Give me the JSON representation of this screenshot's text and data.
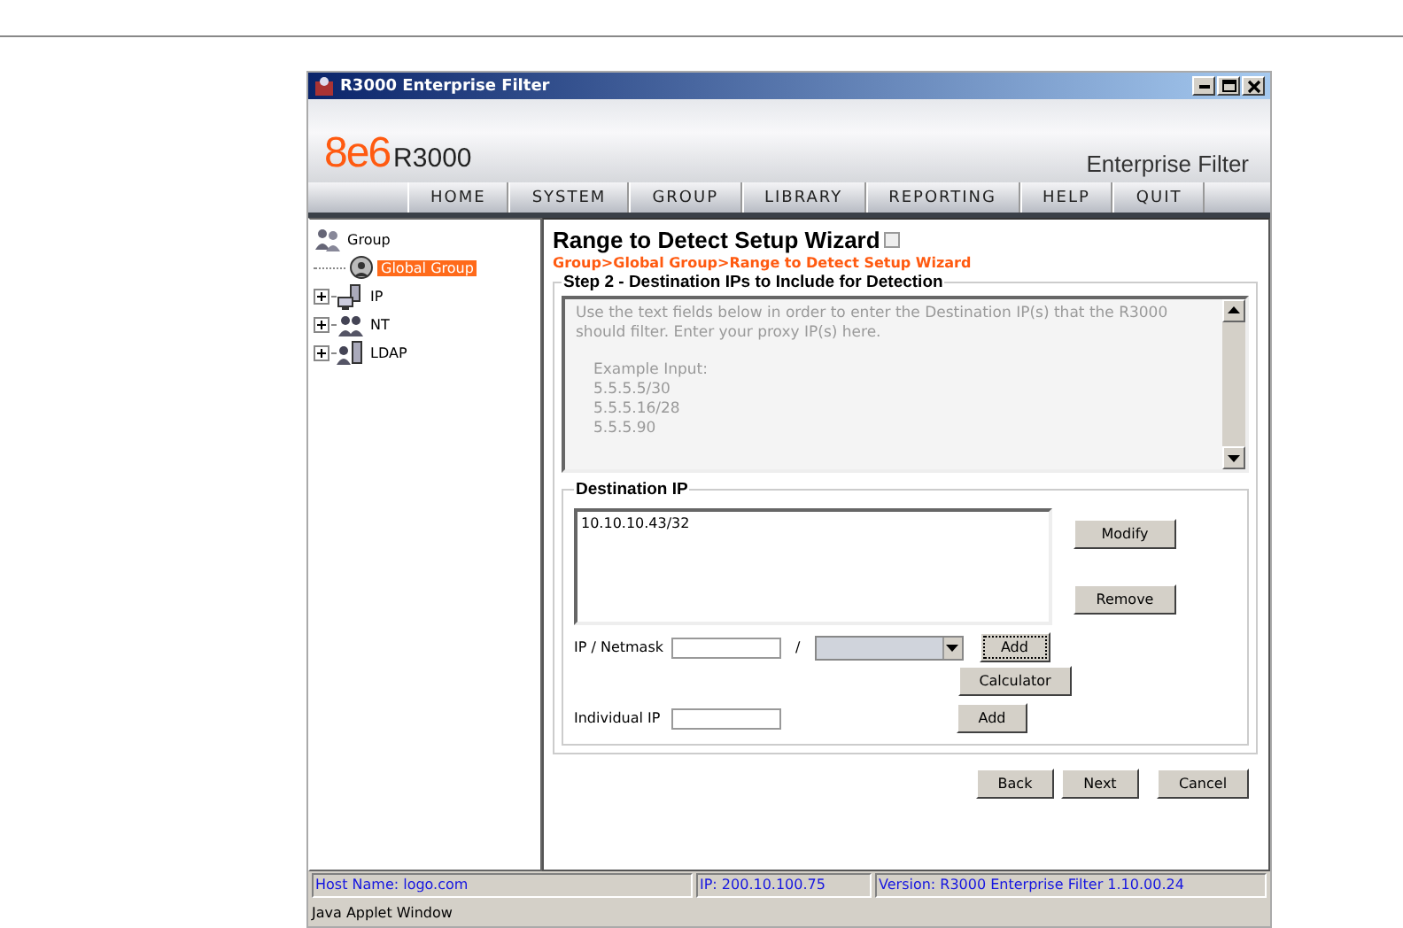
{
  "window": {
    "title": "R3000 Enterprise Filter"
  },
  "banner": {
    "logo_mark": "8e6",
    "logo_product": "R3000",
    "tagline": "Enterprise Filter"
  },
  "nav": [
    {
      "label": "HOME"
    },
    {
      "label": "SYSTEM"
    },
    {
      "label": "GROUP"
    },
    {
      "label": "LIBRARY"
    },
    {
      "label": "REPORTING"
    },
    {
      "label": "HELP"
    },
    {
      "label": "QUIT"
    }
  ],
  "tree": [
    {
      "label": "Group",
      "kind": "group",
      "expanded": true,
      "selected": false,
      "children": [
        {
          "label": "Global Group",
          "kind": "global",
          "selected": true
        },
        {
          "label": "IP",
          "kind": "ip",
          "expanded": false,
          "selected": false
        },
        {
          "label": "NT",
          "kind": "nt",
          "expanded": false,
          "selected": false
        },
        {
          "label": "LDAP",
          "kind": "ldap",
          "expanded": false,
          "selected": false
        }
      ]
    }
  ],
  "wizard": {
    "title": "Range to Detect Setup Wizard",
    "breadcrumb": "Group>Global Group>Range to Detect Setup Wizard",
    "step": "Step 2 - Destination IPs to Include for Detection",
    "instructions": [
      "Use the text fields below in order to enter the Destination IP(s) that the R3000 should filter. Enter your proxy IP(s) here.",
      "Example Input:",
      "5.5.5.5/30",
      "5.5.5.16/28",
      "5.5.5.90"
    ],
    "destination": {
      "legend": "Destination IP",
      "entries": [
        "10.10.10.43/32"
      ],
      "side_buttons": [
        "Modify",
        "Remove"
      ],
      "netmask_label": "IP / Netmask",
      "separator": "/",
      "add_label": "Add",
      "calculator_label": "Calculator",
      "individual_label": "Individual IP",
      "individual_add_label": "Add"
    },
    "buttons": [
      "Back",
      "Next",
      "Cancel"
    ]
  },
  "status_bar": [
    "Host Name: logo.com",
    "IP: 200.10.100.75",
    "Version: R3000 Enterprise Filter 1.10.00.24"
  ],
  "applet_note": "Java Applet Window"
}
